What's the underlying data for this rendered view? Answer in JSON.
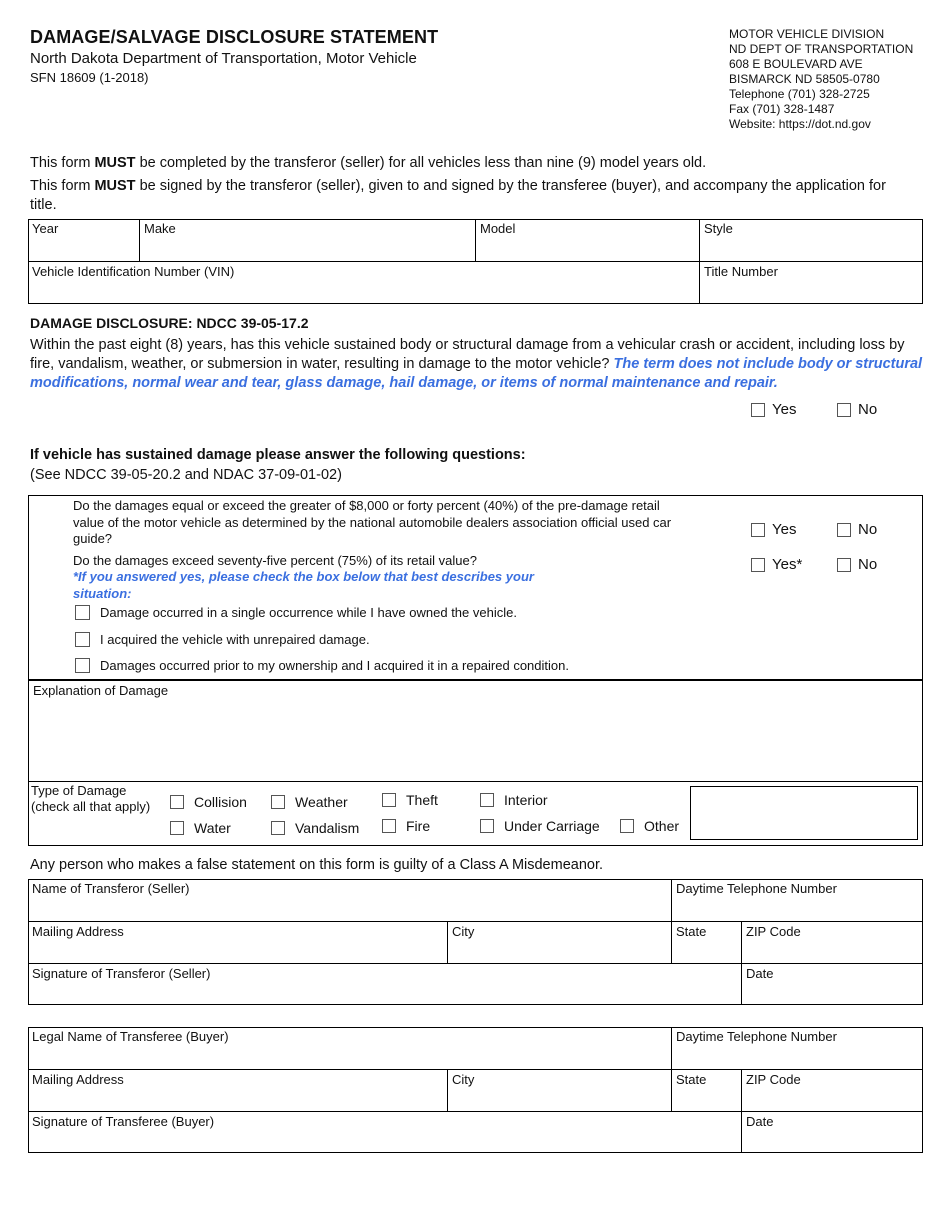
{
  "header": {
    "title": "DAMAGE/SALVAGE DISCLOSURE STATEMENT",
    "subtitle": "North Dakota Department of Transportation, Motor Vehicle",
    "form_number": "SFN 18609 (1-2018)",
    "address_lines": [
      "MOTOR VEHICLE DIVISION",
      "ND DEPT OF TRANSPORTATION",
      "608 E BOULEVARD AVE",
      "BISMARCK ND 58505-0780",
      "Telephone (701) 328-2725",
      "Fax (701) 328-1487",
      "Website: https://dot.nd.gov"
    ]
  },
  "intro": {
    "p1_pre": "This form ",
    "p1_bold": "MUST",
    "p1_post": " be completed by the transferor (seller) for all vehicles less than nine (9) model years old.",
    "p2_pre": "This form ",
    "p2_bold": "MUST",
    "p2_post": " be signed by the transferor (seller), given to and signed by the transferee (buyer), and accompany the application for title."
  },
  "vehicle": {
    "year": "Year",
    "make": "Make",
    "model": "Model",
    "style": "Style",
    "vin": "Vehicle Identification Number (VIN)",
    "title_number": "Title Number"
  },
  "disclosure": {
    "heading": "DAMAGE DISCLOSURE: NDCC 39-05-17.2",
    "question": "Within the past eight (8) years, has this vehicle sustained body or structural damage from a vehicular crash or accident, including loss by fire, vandalism, weather, or submersion in water, resulting in damage to the motor vehicle? ",
    "note": "The term does not include body or structural modifications, normal wear and tear, glass damage, hail damage, or items of normal maintenance and repair.",
    "yes": "Yes",
    "no": "No"
  },
  "followup": {
    "heading": "If vehicle has sustained damage please answer the following questions:",
    "reference": "(See NDCC 39-05-20.2 and NDAC 37-09-01-02)",
    "q1": "Do the damages equal or exceed the greater of $8,000 or forty percent (40%) of the pre-damage retail value of the motor vehicle as determined by the national automobile dealers association official used car guide?",
    "q1_yes": "Yes",
    "q1_no": "No",
    "q2": "Do the damages exceed seventy-five percent (75%) of its retail value?",
    "q2_yes": "Yes*",
    "q2_no": "No",
    "q2_note": "*If you answered yes, please check the box below that best describes your situation:",
    "situations": [
      "Damage occurred in a single occurrence while I have owned the vehicle.",
      "I acquired the vehicle with unrepaired damage.",
      "Damages occurred prior to my ownership and I acquired it in a repaired condition."
    ]
  },
  "explanation": {
    "label": "Explanation of Damage"
  },
  "damage_type": {
    "label_line1": "Type of Damage",
    "label_line2": "(check all that apply)",
    "options": [
      "Collision",
      "Weather",
      "Theft",
      "Interior",
      "Water",
      "Vandalism",
      "Fire",
      "Under Carriage",
      "Other"
    ]
  },
  "warning": "Any person who makes a false statement on this form is guilty of a Class A Misdemeanor.",
  "seller": {
    "name": "Name of Transferor (Seller)",
    "phone": "Daytime Telephone Number",
    "address": "Mailing Address",
    "city": "City",
    "state": "State",
    "zip": "ZIP Code",
    "signature": "Signature of Transferor (Seller)",
    "date": "Date"
  },
  "buyer": {
    "name": "Legal Name of Transferee (Buyer)",
    "phone": "Daytime Telephone Number",
    "address": "Mailing Address",
    "city": "City",
    "state": "State",
    "zip": "ZIP Code",
    "signature": "Signature of Transferee (Buyer)",
    "date": "Date"
  }
}
